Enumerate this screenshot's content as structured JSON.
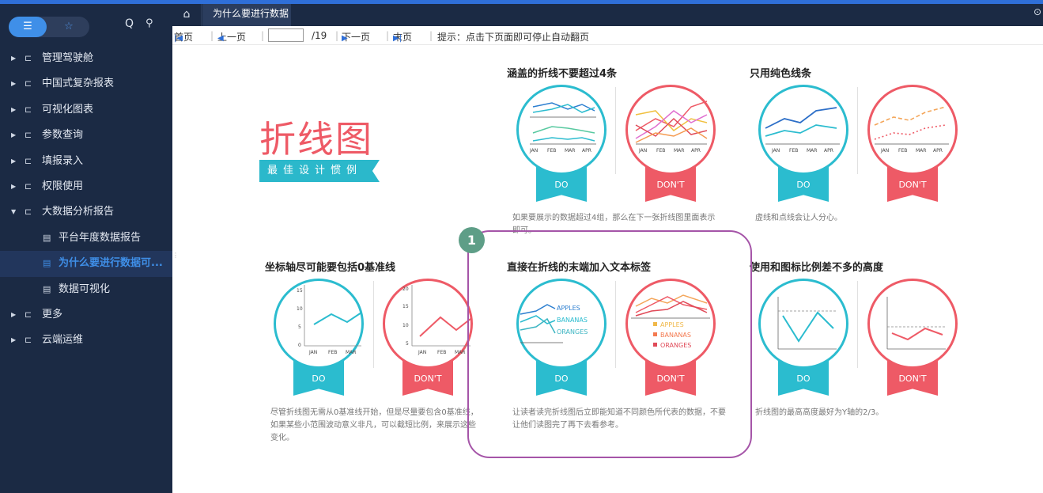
{
  "app": {
    "tab_title": "为什么要进行数据",
    "toggle_left": "☰",
    "toggle_right": "☆",
    "search_icon": "Q",
    "pin_icon": "⚲"
  },
  "sidebar": {
    "items": [
      {
        "label": "管理驾驶舱",
        "type": "folder",
        "expanded": false
      },
      {
        "label": "中国式复杂报表",
        "type": "folder",
        "expanded": false
      },
      {
        "label": "可视化图表",
        "type": "folder",
        "expanded": false
      },
      {
        "label": "参数查询",
        "type": "folder",
        "expanded": false
      },
      {
        "label": "填报录入",
        "type": "folder",
        "expanded": false
      },
      {
        "label": "权限使用",
        "type": "folder",
        "expanded": false
      },
      {
        "label": "大数据分析报告",
        "type": "folder",
        "expanded": true
      },
      {
        "label": "平台年度数据报告",
        "type": "doc"
      },
      {
        "label": "为什么要进行数据可...",
        "type": "doc",
        "active": true
      },
      {
        "label": "数据可视化",
        "type": "doc"
      },
      {
        "label": "更多",
        "type": "folder",
        "expanded": false
      },
      {
        "label": "云端运维",
        "type": "folder",
        "expanded": false
      }
    ]
  },
  "pager": {
    "first": "首页",
    "prev": "上一页",
    "total": "/19",
    "next": "下一页",
    "last": "末页",
    "hint": "提示：点击下页面即可停止自动翻页"
  },
  "report": {
    "hero_title": "折线图",
    "hero_subtitle": "最佳设计惯例",
    "sections": [
      {
        "title": "涵盖的折线不要超过4条",
        "do": "DO",
        "dont": "DON'T",
        "note": "如果要展示的数据超过4组，那么在下一张折线图里面表示即可。"
      },
      {
        "title": "只用纯色线条",
        "do": "DO",
        "dont": "DON'T",
        "note": "虚线和点线会让人分心。"
      },
      {
        "title": "坐标轴尽可能要包括0基准线",
        "do": "DO",
        "dont": "DON'T",
        "note": "尽管折线图无需从0基准线开始，但是尽量要包含0基准线，如果某些小范围波动意义非凡，可以截短比例，来展示这些变化。"
      },
      {
        "title": "直接在折线的末端加入文本标签",
        "do": "DO",
        "dont": "DON'T",
        "note": "让读者读完折线图后立即能知道不同颜色所代表的数据，不要让他们读图完了再下去看参考。"
      },
      {
        "title": "使用和图标比例差不多的高度",
        "do": "DO",
        "dont": "DON'T",
        "note": "折线图的最高高度最好为Y轴的2/3。"
      }
    ],
    "months": [
      "JAN",
      "FEB",
      "MAR",
      "APR"
    ],
    "label_series": [
      "APPLES",
      "BANANAS",
      "ORANGES"
    ],
    "y_ticks_do": [
      "15",
      "10",
      "5",
      "0"
    ],
    "y_ticks_dont": [
      "20",
      "15",
      "10",
      "5"
    ],
    "step_number": "1",
    "colors": {
      "teal": "#2bbccf",
      "red": "#ee5a66",
      "highlight": "#a555a8",
      "step": "#5e9e87"
    }
  }
}
